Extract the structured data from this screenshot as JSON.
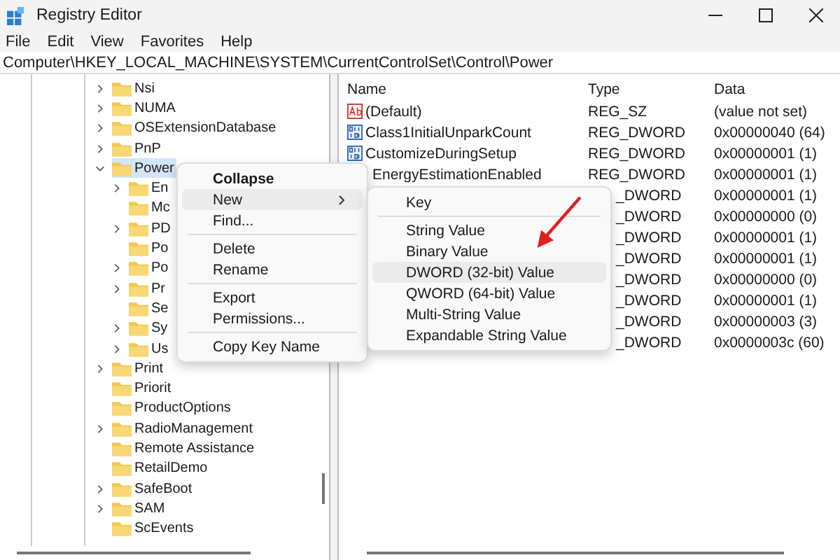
{
  "window": {
    "title": "Registry Editor"
  },
  "menu_bar": [
    "File",
    "Edit",
    "View",
    "Favorites",
    "Help"
  ],
  "address": "Computer\\HKEY_LOCAL_MACHINE\\SYSTEM\\CurrentControlSet\\Control\\Power",
  "tree": {
    "items": [
      {
        "label": "Nsi",
        "expandable": true,
        "expanded": false,
        "selected": false
      },
      {
        "label": "NUMA",
        "expandable": true,
        "expanded": false,
        "selected": false
      },
      {
        "label": "OSExtensionDatabase",
        "expandable": true,
        "expanded": false,
        "selected": false
      },
      {
        "label": "PnP",
        "expandable": true,
        "expanded": false,
        "selected": false
      },
      {
        "label": "Power",
        "expandable": true,
        "expanded": true,
        "selected": true,
        "children": [
          {
            "label": "En",
            "expandable": true,
            "expanded": false,
            "selected": false
          },
          {
            "label": "Mc",
            "expandable": false,
            "selected": false
          },
          {
            "label": "PD",
            "expandable": true,
            "expanded": false,
            "selected": false
          },
          {
            "label": "Po",
            "expandable": false,
            "selected": false
          },
          {
            "label": "Po",
            "expandable": true,
            "expanded": false,
            "selected": false
          },
          {
            "label": "Pr",
            "expandable": true,
            "expanded": false,
            "selected": false
          },
          {
            "label": "Se",
            "expandable": false,
            "selected": false
          },
          {
            "label": "Sy",
            "expandable": true,
            "expanded": false,
            "selected": false
          },
          {
            "label": "Us",
            "expandable": true,
            "expanded": false,
            "selected": false
          }
        ]
      },
      {
        "label": "Print",
        "expandable": true,
        "expanded": false,
        "selected": false
      },
      {
        "label": "Priorit",
        "expandable": false,
        "selected": false
      },
      {
        "label": "ProductOptions",
        "expandable": false,
        "selected": false
      },
      {
        "label": "RadioManagement",
        "expandable": true,
        "expanded": false,
        "selected": false
      },
      {
        "label": "Remote Assistance",
        "expandable": false,
        "selected": false
      },
      {
        "label": "RetailDemo",
        "expandable": false,
        "selected": false
      },
      {
        "label": "SafeBoot",
        "expandable": true,
        "expanded": false,
        "selected": false
      },
      {
        "label": "SAM",
        "expandable": true,
        "expanded": false,
        "selected": false
      },
      {
        "label": "ScEvents",
        "expandable": false,
        "selected": false
      }
    ]
  },
  "values_table": {
    "columns": [
      "Name",
      "Type",
      "Data"
    ],
    "rows": [
      {
        "kind": "string",
        "name": "(Default)",
        "type": "REG_SZ",
        "data": "(value not set)"
      },
      {
        "kind": "binary",
        "name": "Class1InitialUnparkCount",
        "type": "REG_DWORD",
        "data": "0x00000040 (64)"
      },
      {
        "kind": "binary",
        "name": "CustomizeDuringSetup",
        "type": "REG_DWORD",
        "data": "0x00000001 (1)"
      },
      {
        "name": "EnergyEstimationEnabled",
        "type": "REG_DWORD",
        "data": "0x00000001 (1)"
      },
      {
        "type": "_DWORD",
        "data": "0x00000001 (1)"
      },
      {
        "type": "_DWORD",
        "data": "0x00000000 (0)"
      },
      {
        "type": "_DWORD",
        "data": "0x00000001 (1)"
      },
      {
        "type": "_DWORD",
        "data": "0x00000001 (1)"
      },
      {
        "type": "_DWORD",
        "data": "0x00000000 (0)"
      },
      {
        "type": "_DWORD",
        "data": "0x00000001 (1)"
      },
      {
        "type": "_DWORD",
        "data": "0x00000003 (3)"
      },
      {
        "type": "_DWORD",
        "data": "0x0000003c (60)"
      }
    ]
  },
  "context_menu": {
    "groups": [
      [
        {
          "label": "Collapse",
          "bold": true,
          "selected": false,
          "has_submenu": false
        },
        {
          "label": "New",
          "bold": false,
          "selected": true,
          "has_submenu": true
        },
        {
          "label": "Find...",
          "bold": false,
          "selected": false,
          "has_submenu": false
        }
      ],
      [
        {
          "label": "Delete",
          "bold": false,
          "selected": false,
          "has_submenu": false
        },
        {
          "label": "Rename",
          "bold": false,
          "selected": false,
          "has_submenu": false
        }
      ],
      [
        {
          "label": "Export",
          "bold": false,
          "selected": false,
          "has_submenu": false
        },
        {
          "label": "Permissions...",
          "bold": false,
          "selected": false,
          "has_submenu": false
        }
      ],
      [
        {
          "label": "Copy Key Name",
          "bold": false,
          "selected": false,
          "has_submenu": false
        }
      ]
    ]
  },
  "submenu": {
    "groups": [
      [
        {
          "label": "Key",
          "selected": false
        }
      ],
      [
        {
          "label": "String Value",
          "selected": false
        },
        {
          "label": "Binary Value",
          "selected": false
        },
        {
          "label": "DWORD (32-bit) Value",
          "selected": true
        },
        {
          "label": "QWORD (64-bit) Value",
          "selected": false
        },
        {
          "label": "Multi-String Value",
          "selected": false
        },
        {
          "label": "Expandable String Value",
          "selected": false
        }
      ]
    ]
  }
}
